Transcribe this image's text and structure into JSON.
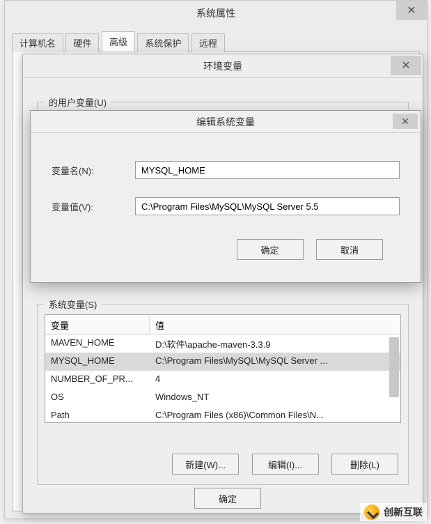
{
  "sysprops": {
    "title": "系统属性",
    "tabs": [
      "计算机名",
      "硬件",
      "高级",
      "系统保护",
      "远程"
    ],
    "active_tab": 2
  },
  "envdlg": {
    "title": "环境变量",
    "user_vars_label_partial": "的用户变量(U)",
    "sysvars_label": "系统变量(S)",
    "table": {
      "col_var": "变量",
      "col_val": "值",
      "rows": [
        {
          "name": "MAVEN_HOME",
          "value": "D:\\软件\\apache-maven-3.3.9",
          "selected": false
        },
        {
          "name": "MYSQL_HOME",
          "value": "C:\\Program Files\\MySQL\\MySQL Server ...",
          "selected": true
        },
        {
          "name": "NUMBER_OF_PR...",
          "value": "4",
          "selected": false
        },
        {
          "name": "OS",
          "value": "Windows_NT",
          "selected": false
        },
        {
          "name": "Path",
          "value": "C:\\Program Files (x86)\\Common Files\\N...",
          "selected": false
        }
      ]
    },
    "new_btn": "新建(W)...",
    "edit_btn": "编辑(I)...",
    "del_btn": "删除(L)",
    "ok_btn": "确定"
  },
  "editdlg": {
    "title": "编辑系统变量",
    "name_label": "变量名(N):",
    "value_label": "变量值(V):",
    "name_value": "MYSQL_HOME",
    "value_value": "C:\\Program Files\\MySQL\\MySQL Server 5.5",
    "ok_btn": "确定",
    "cancel_btn": "取消"
  },
  "watermark": "创新互联"
}
